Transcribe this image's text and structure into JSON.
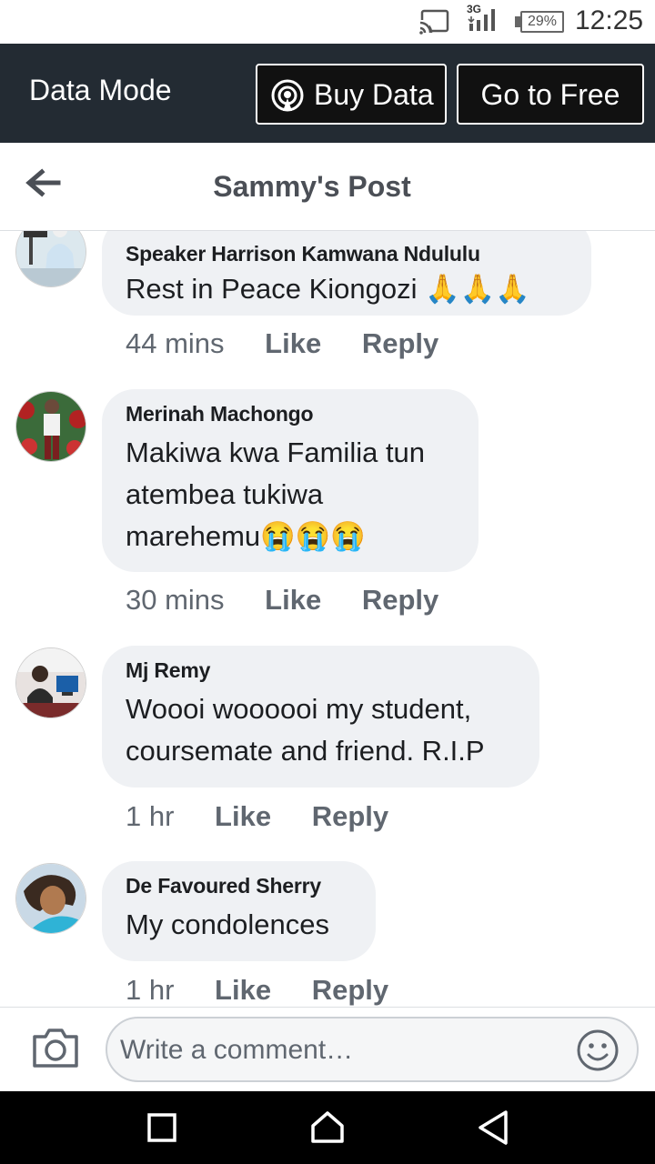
{
  "status_bar": {
    "network": "3G",
    "battery": "29%",
    "time": "12:25"
  },
  "data_bar": {
    "mode_label": "Data Mode",
    "buy_data_label": "Buy Data",
    "go_free_label": "Go to Free"
  },
  "header": {
    "title": "Sammy's Post"
  },
  "comments": [
    {
      "author": "Speaker Harrison Kamwana Ndululu",
      "lines": [
        "Rest in Peace Kiongozi 🙏🙏🙏"
      ],
      "time": "44 mins",
      "like": "Like",
      "reply": "Reply"
    },
    {
      "author": "Merinah Machongo",
      "lines": [
        "Makiwa kwa Familia tun",
        "atembea tukiwa",
        "marehemu😭😭😭"
      ],
      "time": "30 mins",
      "like": "Like",
      "reply": "Reply"
    },
    {
      "author": "Mj Remy",
      "lines": [
        "Woooi woooooi my student,",
        "coursemate and friend. R.I.P"
      ],
      "time": "1 hr",
      "like": "Like",
      "reply": "Reply"
    },
    {
      "author": "De Favoured Sherry",
      "lines": [
        "My condolences"
      ],
      "time": "1 hr",
      "like": "Like",
      "reply": "Reply"
    }
  ],
  "compose": {
    "placeholder": "Write a comment…"
  },
  "icons": {
    "cast": "cast-icon",
    "signal": "signal-icon",
    "battery": "battery-icon",
    "buy_data": "broadcast-icon",
    "back": "arrow-left-icon",
    "camera": "camera-icon",
    "emoji": "smiley-icon",
    "nav_recent": "square-icon",
    "nav_home": "home-icon",
    "nav_back": "triangle-back-icon"
  },
  "colors": {
    "data_bar_bg": "#232b33",
    "bubble_bg": "#eff1f4",
    "meta_text": "#606770"
  }
}
